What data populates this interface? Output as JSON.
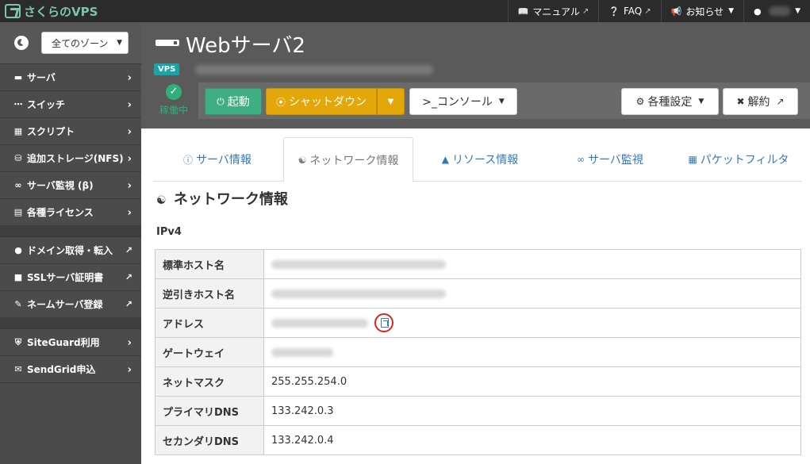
{
  "app": {
    "logo_text": "さくらのVPS"
  },
  "topnav": {
    "manual": "マニュアル",
    "faq": "FAQ",
    "news": "お知らせ"
  },
  "sidebar": {
    "zone_select": "全てのゾーン",
    "items": [
      {
        "label": "サーバ",
        "icon": "server-icon"
      },
      {
        "label": "スイッチ",
        "icon": "switch-icon"
      },
      {
        "label": "スクリプト",
        "icon": "script-icon"
      },
      {
        "label": "追加ストレージ(NFS)",
        "icon": "database-icon"
      },
      {
        "label": "サーバ監視 (β)",
        "icon": "binoculars-icon"
      },
      {
        "label": "各種ライセンス",
        "icon": "license-icon"
      }
    ],
    "external_items": [
      {
        "label": "ドメイン取得・転入",
        "icon": "globe-icon"
      },
      {
        "label": "SSLサーバ証明書",
        "icon": "lock-icon"
      },
      {
        "label": "ネームサーバ登録",
        "icon": "edit-icon"
      }
    ],
    "extra_items": [
      {
        "label": "SiteGuard利用",
        "icon": "shield-icon"
      },
      {
        "label": "SendGrid申込",
        "icon": "mail-icon"
      }
    ]
  },
  "server": {
    "title": "Webサーバ2",
    "badge": "VPS",
    "status": "稼働中"
  },
  "actions": {
    "boot": "起動",
    "shutdown": "シャットダウン",
    "console": ">_コンソール",
    "settings": "各種設定",
    "cancel": "解約"
  },
  "tabs": {
    "server_info": "サーバ情報",
    "network_info": "ネットワーク情報",
    "resource_info": "リソース情報",
    "server_monitor": "サーバ監視",
    "packet_filter": "パケットフィルタ"
  },
  "section": {
    "title": "ネットワーク情報",
    "subtitle": "IPv4"
  },
  "network_table": {
    "rows": [
      {
        "key": "標準ホスト名",
        "value": ""
      },
      {
        "key": "逆引きホスト名",
        "value": ""
      },
      {
        "key": "アドレス",
        "value": ""
      },
      {
        "key": "ゲートウェイ",
        "value": ""
      },
      {
        "key": "ネットマスク",
        "value": "255.255.254.0"
      },
      {
        "key": "プライマリDNS",
        "value": "133.242.0.3"
      },
      {
        "key": "セカンダリDNS",
        "value": "133.242.0.4"
      }
    ]
  },
  "colors": {
    "header_bg": "#5a5a5a",
    "sidebar_bg": "#4b4b4b",
    "boot_green": "#3fae85",
    "shutdown_orange": "#e4a709",
    "link_blue": "#337ab7",
    "highlight_red": "#d9251d"
  }
}
